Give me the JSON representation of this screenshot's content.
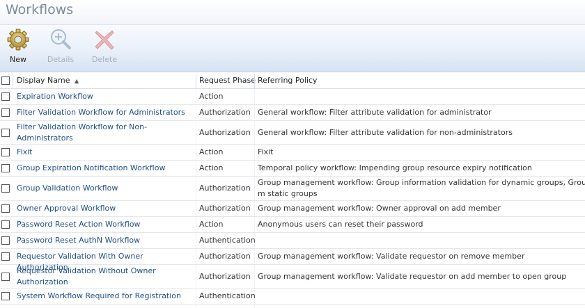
{
  "page": {
    "title": "Workflows"
  },
  "toolbar": {
    "new_label": "New",
    "details_label": "Details",
    "delete_label": "Delete"
  },
  "table": {
    "columns": {
      "display_name": "Display Name",
      "request_phase": "Request Phase",
      "referring_policy": "Referring Policy"
    },
    "sort_indicator": "▲",
    "rows": [
      {
        "name": "Expiration Workflow",
        "phase": "Action",
        "policy": ""
      },
      {
        "name": "Filter Validation Workflow for Administrators",
        "phase": "Authorization",
        "policy": "General workflow: Filter attribute validation for administrator"
      },
      {
        "name": "Filter Validation Workflow for Non-Administrators",
        "phase": "Authorization",
        "policy": "General workflow: Filter attribute validation for non-administrators"
      },
      {
        "name": "Fixit",
        "phase": "Action",
        "policy": "Fixit"
      },
      {
        "name": "Group Expiration Notification Workflow",
        "phase": "Action",
        "policy": "Temporal policy workflow: Impending group resource expiry notification"
      },
      {
        "name": "Group Validation Workflow",
        "phase": "Authorization",
        "policy": "Group management workflow: Group information validation for dynamic groups, Group m static groups"
      },
      {
        "name": "Owner Approval Workflow",
        "phase": "Authorization",
        "policy": "Group management workflow: Owner approval on add member"
      },
      {
        "name": "Password Reset Action Workflow",
        "phase": "Action",
        "policy": "Anonymous users can reset their password"
      },
      {
        "name": "Password Reset AuthN Workflow",
        "phase": "Authentication",
        "policy": ""
      },
      {
        "name": "Requestor Validation With Owner Authorization",
        "phase": "Authorization",
        "policy": "Group management workflow: Validate requestor on remove member"
      },
      {
        "name": "Requestor Validation Without Owner Authorization",
        "phase": "Authorization",
        "policy": "Group management workflow: Validate requestor on add member to open group"
      },
      {
        "name": "System Workflow Required for Registration",
        "phase": "Authentication",
        "policy": ""
      }
    ]
  }
}
